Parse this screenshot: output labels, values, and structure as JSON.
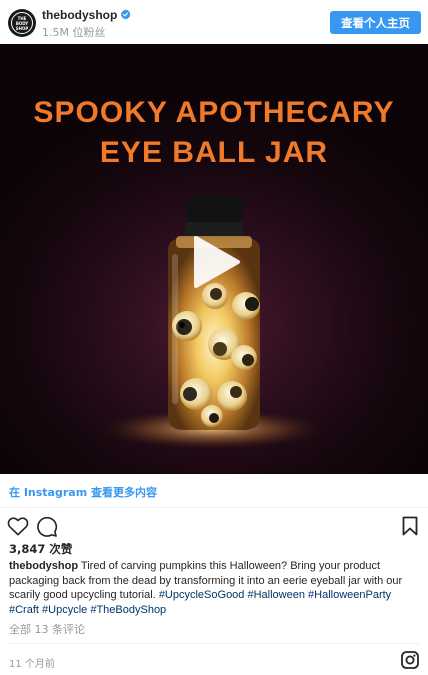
{
  "header": {
    "avatar_text": [
      "THE",
      "BODY",
      "SHOP"
    ],
    "username": "thebodyshop",
    "followers": "1.5M 位粉丝",
    "profile_button": "查看个人主页"
  },
  "media": {
    "title_line1": "SPOOKY APOTHECARY",
    "title_line2": "EYE BALL JAR",
    "type": "video"
  },
  "link": {
    "instagram_link": "在 Instagram 查看更多内容"
  },
  "post": {
    "likes": "3,847 次赞",
    "caption_user": "thebodyshop",
    "caption_text": "Tired of carving pumpkins this Halloween? Bring your product packaging back from the dead by transforming it into an eerie eyeball jar with our scarily good upcycling tutorial.",
    "hashtags": [
      "#UpcycleSoGood",
      "#Halloween",
      "#HalloweenParty",
      "#Craft",
      "#Upcycle",
      "#TheBodyShop"
    ],
    "comments_link": "全部 13 条评论",
    "timestamp": "11 个月前"
  },
  "colors": {
    "accent": "#3897f0",
    "title_orange": "#f07a2c",
    "hashtag": "#003569",
    "muted": "#999999"
  },
  "icons": [
    "verified-badge-icon",
    "play-icon",
    "heart-icon",
    "comment-icon",
    "bookmark-icon",
    "instagram-logo-icon"
  ]
}
